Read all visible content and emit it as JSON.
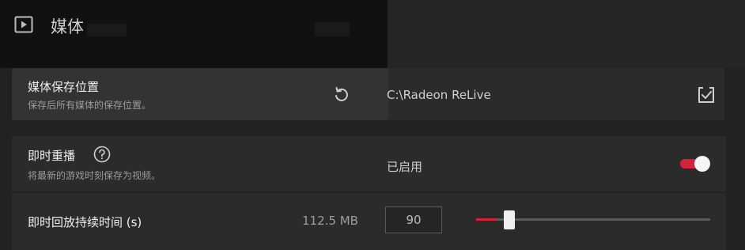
{
  "header": {
    "title": "媒体",
    "icon": "play-square-icon"
  },
  "media_location": {
    "title": "媒体保存位置",
    "subtitle": "保存后所有媒体的保存位置。",
    "path": "C:\\Radeon ReLive",
    "reset_icon": "reset-icon",
    "browse_icon": "folder-select-icon"
  },
  "instant_replay": {
    "title": "即时重播",
    "subtitle": "将最新的游戏时刻保存为视频。",
    "help_icon": "help-icon",
    "status": "已启用",
    "enabled": true
  },
  "replay_duration": {
    "title": "即时回放持续时间 (s)",
    "size": "112.5 MB",
    "value": "90",
    "slider_fraction": 0.085
  },
  "colors": {
    "accent": "#d6213b",
    "background": "#222222",
    "panel": "#2b2b2b"
  }
}
